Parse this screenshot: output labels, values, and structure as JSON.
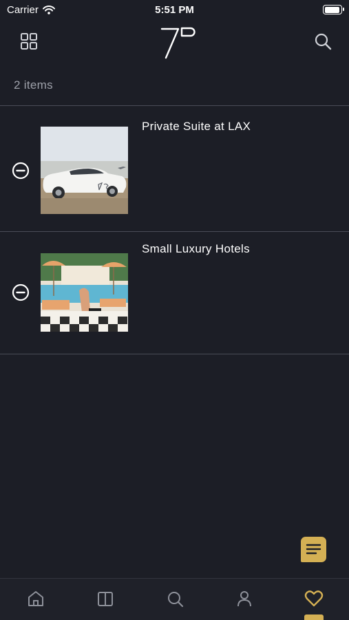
{
  "status_bar": {
    "carrier": "Carrier",
    "time": "5:51 PM",
    "battery_level": 1.0
  },
  "header": {
    "grid_icon": "grid-icon",
    "logo_icon": "seven-p-logo",
    "search_icon": "search-icon"
  },
  "list": {
    "count_label": "2 items",
    "items": [
      {
        "title": "Private Suite at LAX",
        "image": "white-sedan-photo"
      },
      {
        "title": "Small Luxury Hotels",
        "image": "pool-cabana-photo"
      }
    ]
  },
  "chat_fab": {
    "icon": "chat-icon"
  },
  "tab_bar": {
    "tabs": [
      "home-icon",
      "book-icon",
      "search-icon",
      "profile-icon",
      "heart-icon"
    ],
    "active_index": 4
  },
  "colors": {
    "background": "#1c1e26",
    "accent": "#d4b054",
    "muted_text": "#9ea1aa",
    "divider": "#4a4d57"
  }
}
